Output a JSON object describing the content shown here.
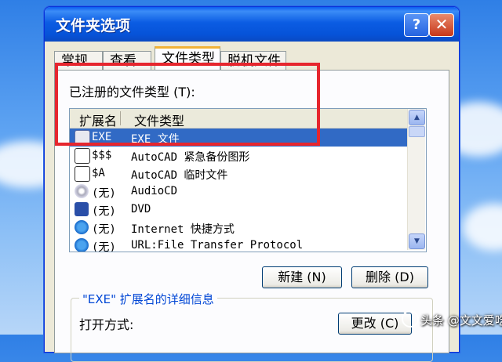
{
  "window": {
    "title": "文件夹选项",
    "help": "?",
    "close": "✕"
  },
  "tabs": [
    "常规",
    "查看",
    "文件类型",
    "脱机文件"
  ],
  "registered_label": "已注册的文件类型 (T):",
  "list": {
    "headers": [
      "扩展名",
      "文件类型"
    ],
    "rows": [
      {
        "ext": "EXE",
        "type": "EXE 文件",
        "icon": "exe-icon",
        "selected": true
      },
      {
        "ext": "$$$",
        "type": "AutoCAD 紧急备份图形",
        "icon": "acad-icon"
      },
      {
        "ext": "$A",
        "type": "AutoCAD 临时文件",
        "icon": "acad-icon"
      },
      {
        "ext": "(无)",
        "type": "AudioCD",
        "icon": "cd-icon"
      },
      {
        "ext": "(无)",
        "type": "DVD",
        "icon": "dvd-icon"
      },
      {
        "ext": "(无)",
        "type": "Internet 快捷方式",
        "icon": "ie-icon"
      },
      {
        "ext": "(无)",
        "type": "URL:File Transfer Protocol",
        "icon": "ie-icon"
      }
    ]
  },
  "buttons": {
    "new": "新建 (N)",
    "delete": "删除 (D)",
    "change": "更改 (C)"
  },
  "details": {
    "title": "\"EXE\" 扩展名的详细信息",
    "open_with": "打开方式:"
  },
  "watermark": "头条 @文文爱吃肉",
  "colors": {
    "titlebar": "#0653d8",
    "selection": "#316ac5",
    "highlight": "#e6262e"
  }
}
